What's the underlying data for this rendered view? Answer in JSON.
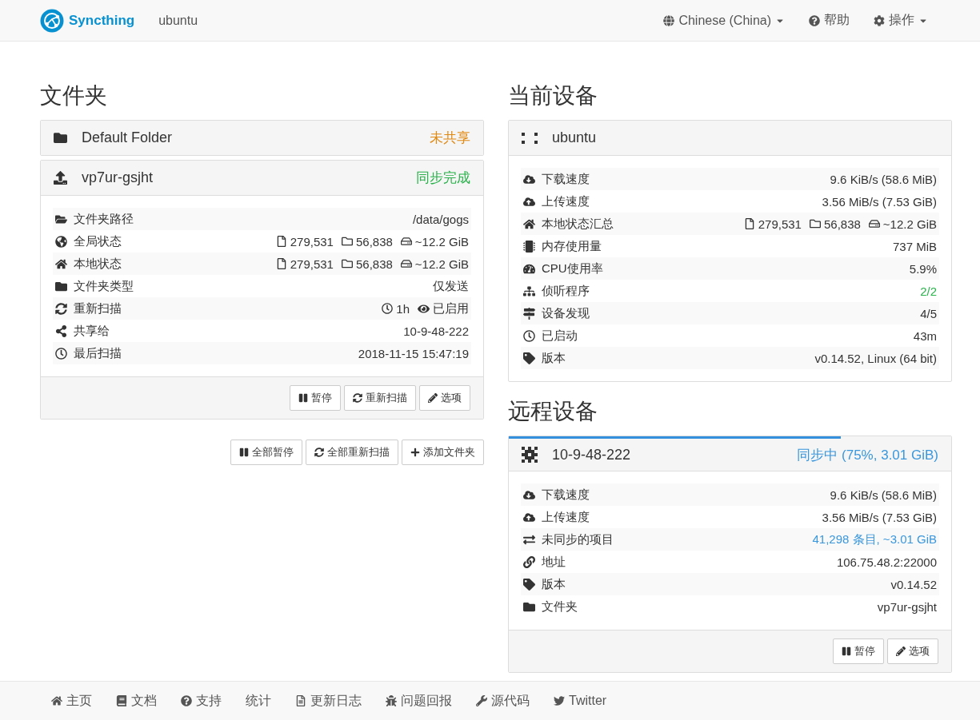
{
  "navbar": {
    "brand": "Syncthing",
    "device_name": "ubuntu",
    "language": "Chinese (China)",
    "help": "帮助",
    "actions": "操作"
  },
  "folders_section": {
    "title": "文件夹",
    "folders": [
      {
        "name": "Default Folder",
        "status": "未共享",
        "color": "#e08a14",
        "expanded": false
      },
      {
        "name": "vp7ur-gsjht",
        "status": "同步完成",
        "color": "#2ab24b",
        "expanded": true,
        "rows": [
          {
            "label": "文件夹路径",
            "kind": "text",
            "value": "/data/gogs"
          },
          {
            "label": "全局状态",
            "kind": "counts",
            "files": "279,531",
            "dirs": "56,838",
            "size": "~12.2 GiB"
          },
          {
            "label": "本地状态",
            "kind": "counts",
            "files": "279,531",
            "dirs": "56,838",
            "size": "~12.2 GiB"
          },
          {
            "label": "文件夹类型",
            "kind": "text",
            "value": "仅发送"
          },
          {
            "label": "重新扫描",
            "kind": "rescan",
            "interval": "1h",
            "watcher": "已启用"
          },
          {
            "label": "共享给",
            "kind": "text",
            "value": "10-9-48-222"
          },
          {
            "label": "最后扫描",
            "kind": "text",
            "value": "2018-11-15 15:47:19"
          }
        ],
        "buttons": [
          "暂停",
          "重新扫描",
          "选项"
        ]
      }
    ],
    "buttons": [
      "全部暂停",
      "全部重新扫描",
      "添加文件夹"
    ]
  },
  "this_device": {
    "title": "当前设备",
    "name": "ubuntu",
    "rows": [
      {
        "label": "下载速度",
        "kind": "text",
        "value": "9.6 KiB/s (58.6 MiB)"
      },
      {
        "label": "上传速度",
        "kind": "text",
        "value": "3.56 MiB/s (7.53 GiB)"
      },
      {
        "label": "本地状态汇总",
        "kind": "counts",
        "files": "279,531",
        "dirs": "56,838",
        "size": "~12.2 GiB"
      },
      {
        "label": "内存使用量",
        "kind": "text",
        "value": "737 MiB"
      },
      {
        "label": "CPU使用率",
        "kind": "text",
        "value": "5.9%"
      },
      {
        "label": "侦听程序",
        "kind": "text",
        "value": "2/2",
        "color": "#2ab24b"
      },
      {
        "label": "设备发现",
        "kind": "text",
        "value": "4/5"
      },
      {
        "label": "已启动",
        "kind": "text",
        "value": "43m"
      },
      {
        "label": "版本",
        "kind": "text",
        "value": "v0.14.52, Linux (64 bit)"
      }
    ]
  },
  "remote_devices": {
    "title": "远程设备",
    "devices": [
      {
        "name": "10-9-48-222",
        "status": "同步中",
        "status_detail": "(75%, 3.01 GiB)",
        "level": 0.75,
        "rows": [
          {
            "label": "下载速度",
            "kind": "text",
            "value": "9.6 KiB/s (58.6 MiB)"
          },
          {
            "label": "上传速度",
            "kind": "text",
            "value": "3.56 MiB/s (7.53 GiB)"
          },
          {
            "label": "未同步的项目",
            "kind": "text",
            "value": "41,298 条目, ~3.01 GiB",
            "color": "#3a97dc"
          },
          {
            "label": "地址",
            "kind": "text",
            "value": "106.75.48.2:22000"
          },
          {
            "label": "版本",
            "kind": "text",
            "value": "v0.14.52"
          },
          {
            "label": "文件夹",
            "kind": "text",
            "value": "vp7ur-gsjht"
          }
        ],
        "buttons": [
          "暂停",
          "选项"
        ]
      }
    ]
  },
  "footer": {
    "links": [
      "主页",
      "文档",
      "支持",
      "统计",
      "更新日志",
      "问题回报",
      "源代码",
      "Twitter"
    ]
  }
}
